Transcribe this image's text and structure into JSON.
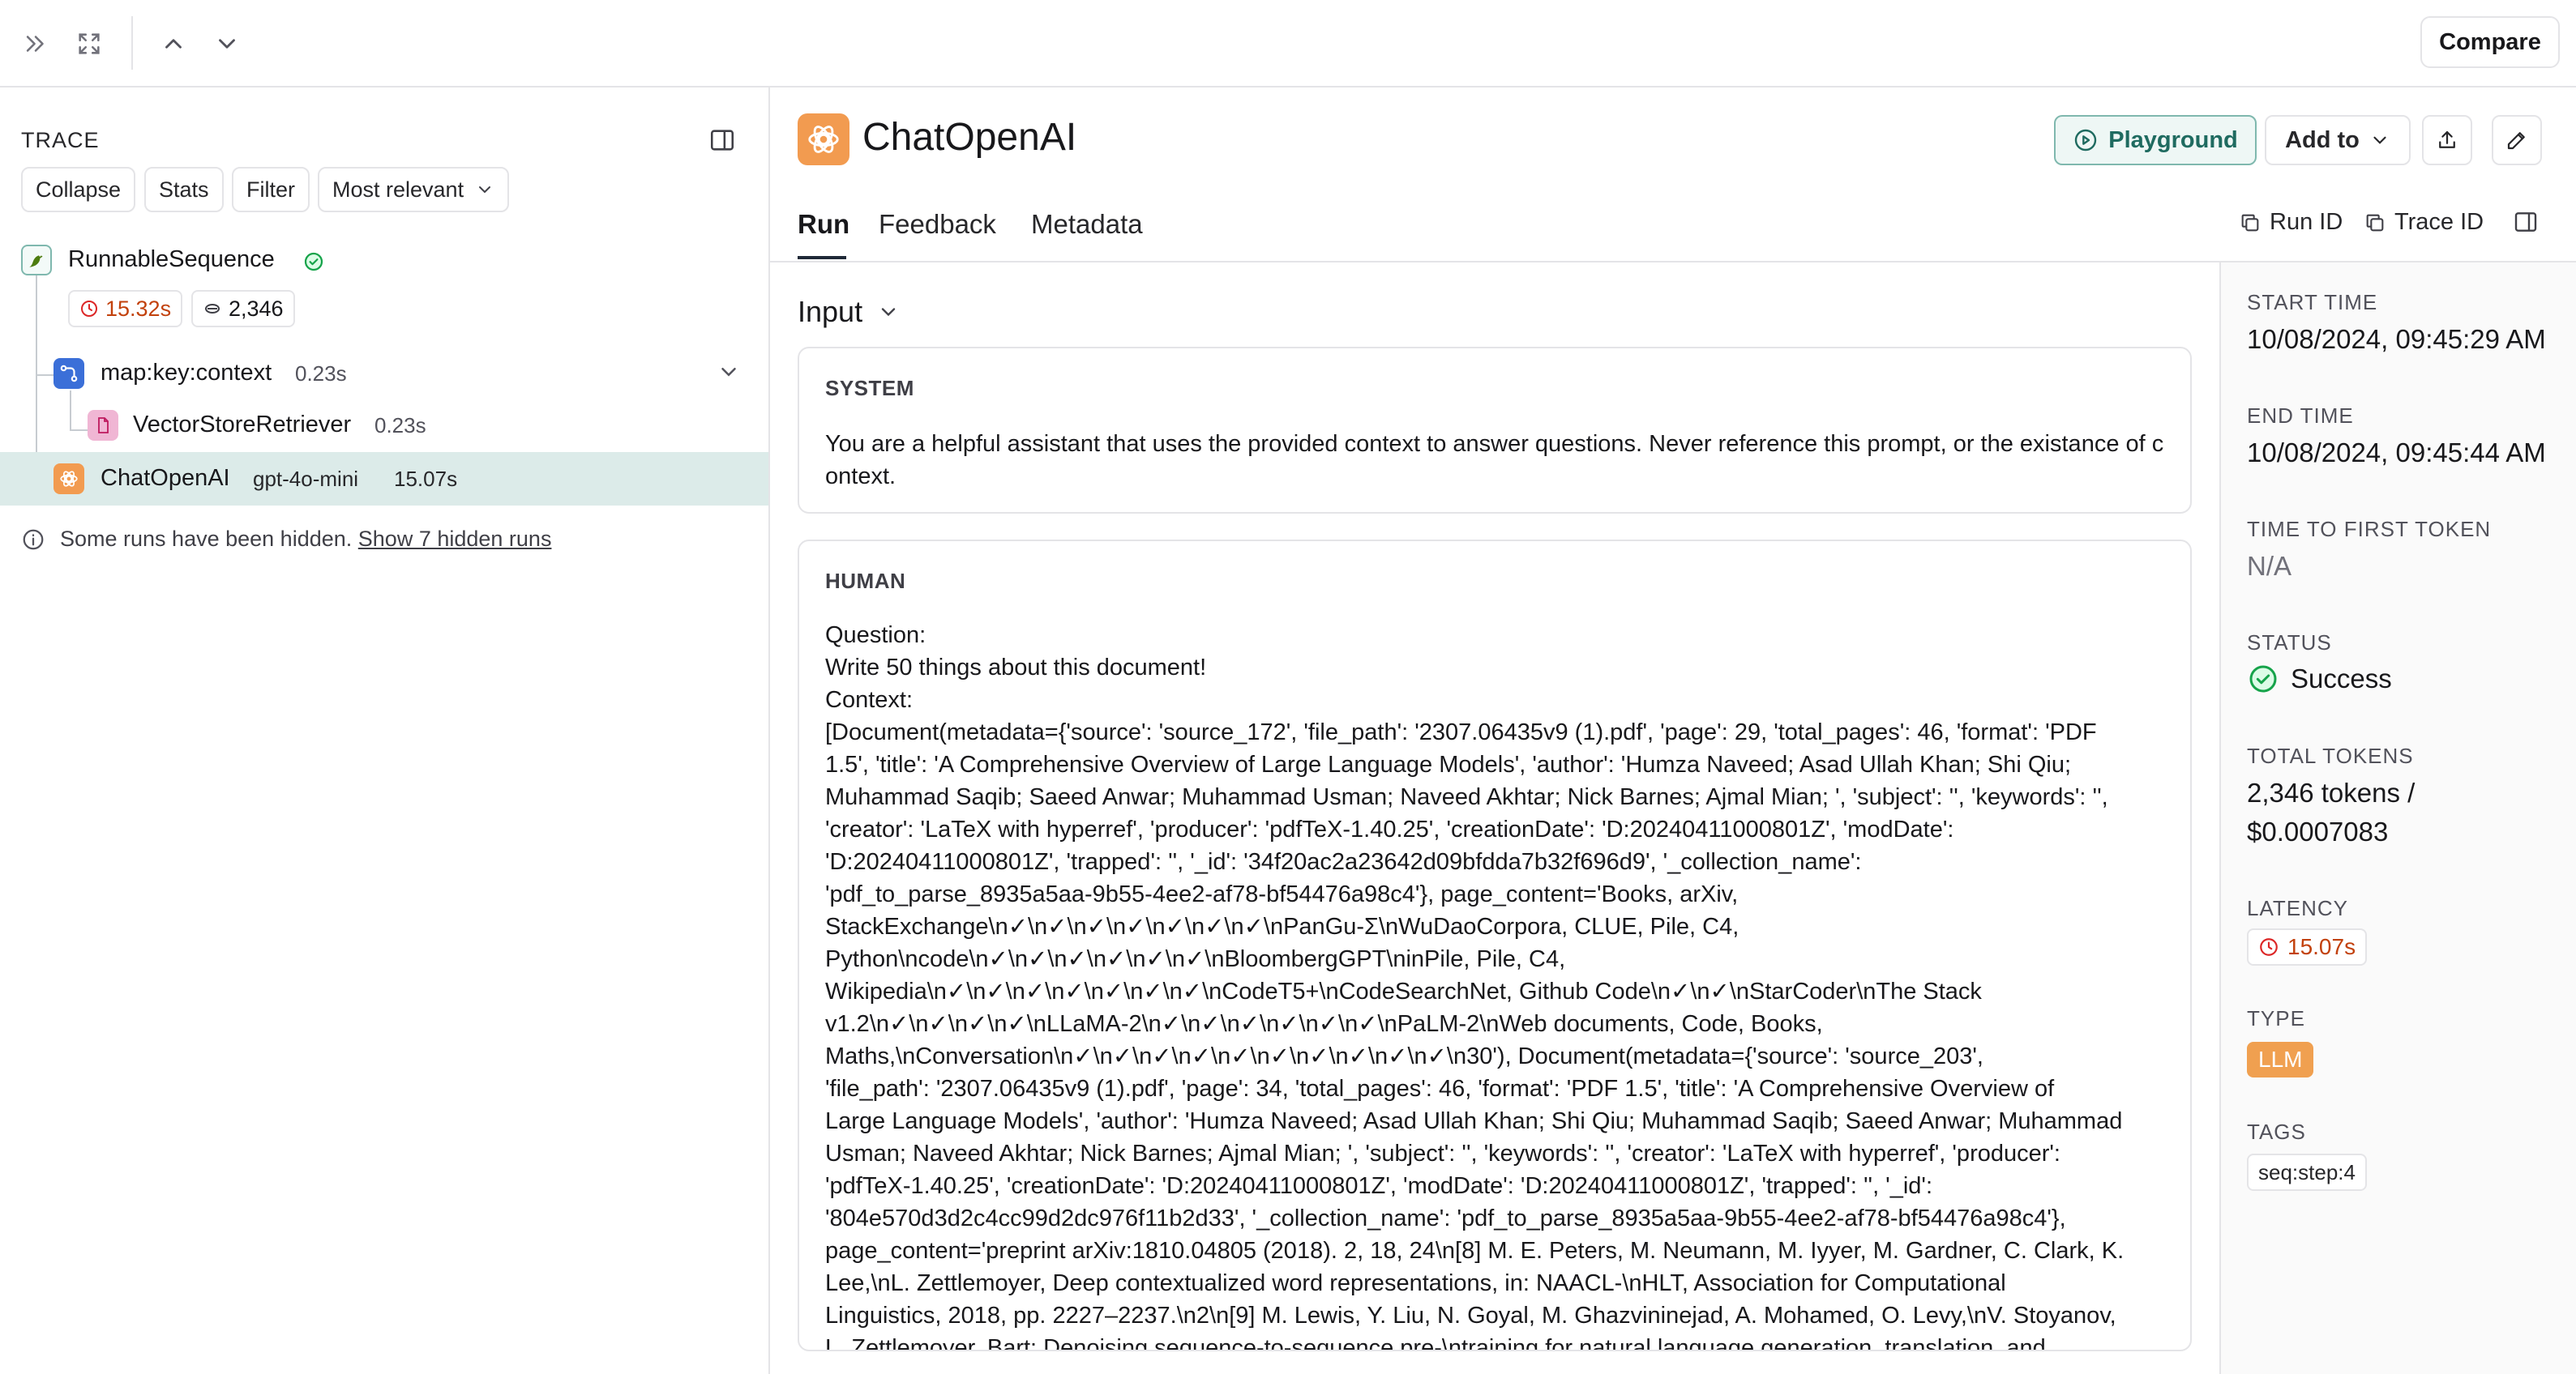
{
  "topbar": {
    "compare_label": "Compare"
  },
  "trace": {
    "title": "TRACE",
    "buttons": {
      "collapse": "Collapse",
      "stats": "Stats",
      "filter": "Filter",
      "sort": "Most relevant"
    },
    "root": {
      "name": "RunnableSequence",
      "latency": "15.32s",
      "tokens": "2,346"
    },
    "nodes": [
      {
        "name": "map:key:context",
        "latency": "0.23s"
      },
      {
        "name": "VectorStoreRetriever",
        "latency": "0.23s"
      },
      {
        "name": "ChatOpenAI",
        "model": "gpt-4o-mini",
        "latency": "15.07s"
      }
    ],
    "hidden_note": "Some runs have been hidden.",
    "hidden_link": "Show 7 hidden runs"
  },
  "run": {
    "title": "ChatOpenAI",
    "buttons": {
      "playground": "Playground",
      "add_to": "Add to"
    },
    "tabs": [
      "Run",
      "Feedback",
      "Metadata"
    ],
    "run_id_label": "Run ID",
    "trace_id_label": "Trace ID",
    "input_label": "Input",
    "system": {
      "label": "SYSTEM",
      "text": "You are a helpful assistant that uses the provided context to answer questions. Never reference this prompt, or the existance of context."
    },
    "human": {
      "label": "HUMAN",
      "lines": [
        "Question:",
        "Write 50 things about this document!",
        "Context:",
        "[Document(metadata={'source': 'source_172', 'file_path': '2307.06435v9 (1).pdf', 'page': 29, 'total_pages': 46, 'format': 'PDF",
        "1.5', 'title': 'A Comprehensive Overview of Large Language Models', 'author': 'Humza Naveed; Asad Ullah Khan; Shi Qiu;",
        "Muhammad Saqib; Saeed Anwar; Muhammad Usman; Naveed Akhtar; Nick Barnes; Ajmal Mian; ', 'subject': '', 'keywords': '',",
        "'creator': 'LaTeX with hyperref', 'producer': 'pdfTeX-1.40.25', 'creationDate': 'D:20240411000801Z', 'modDate':",
        "'D:20240411000801Z', 'trapped': '', '_id': '34f20ac2a23642d09bfdda7b32f696d9', '_collection_name':",
        "'pdf_to_parse_8935a5aa-9b55-4ee2-af78-bf54476a98c4'}, page_content='Books, arXiv,",
        "StackExchange\\n✓\\n✓\\n✓\\n✓\\n✓\\n✓\\n✓\\nPanGu-Σ\\nWuDaoCorpora, CLUE, Pile, C4,",
        "Python\\ncode\\n✓\\n✓\\n✓\\n✓\\n✓\\n✓\\nBloombergGPT\\ninPile, Pile, C4,",
        "Wikipedia\\n✓\\n✓\\n✓\\n✓\\n✓\\n✓\\n✓\\nCodeT5+\\nCodeSearchNet, Github Code\\n✓\\n✓\\nStarCoder\\nThe Stack",
        "v1.2\\n✓\\n✓\\n✓\\n✓\\nLLaMA-2\\n✓\\n✓\\n✓\\n✓\\n✓\\n✓\\nPaLM-2\\nWeb documents, Code, Books,",
        "Maths,\\nConversation\\n✓\\n✓\\n✓\\n✓\\n✓\\n✓\\n✓\\n✓\\n✓\\n✓\\n30'), Document(metadata={'source': 'source_203',",
        "'file_path': '2307.06435v9 (1).pdf', 'page': 34, 'total_pages': 46, 'format': 'PDF 1.5', 'title': 'A Comprehensive Overview of",
        "Large Language Models', 'author': 'Humza Naveed; Asad Ullah Khan; Shi Qiu; Muhammad Saqib; Saeed Anwar; Muhammad",
        "Usman; Naveed Akhtar; Nick Barnes; Ajmal Mian; ', 'subject': '', 'keywords': '', 'creator': 'LaTeX with hyperref', 'producer':",
        "'pdfTeX-1.40.25', 'creationDate': 'D:20240411000801Z', 'modDate': 'D:20240411000801Z', 'trapped': '', '_id':",
        "'804e570d3d2c4cc99d2dc976f11b2d33', '_collection_name': 'pdf_to_parse_8935a5aa-9b55-4ee2-af78-bf54476a98c4'},",
        "page_content='preprint arXiv:1810.04805 (2018). 2, 18, 24\\n[8] M. E. Peters, M. Neumann, M. Iyyer, M. Gardner, C. Clark, K.",
        "Lee,\\nL. Zettlemoyer, Deep contextualized word representations, in: NAACL-\\nHLT, Association for Computational",
        "Linguistics, 2018, pp. 2227–2237.\\n2\\n[9] M. Lewis, Y. Liu, N. Goyal, M. Ghazvininejad, A. Mohamed, O. Levy,\\nV. Stoyanov,",
        "L. Zettlemoyer, Bart: Denoising sequence-to-sequence pre-\\ntraining for natural language generation, translation, and"
      ]
    }
  },
  "meta": {
    "start_time_label": "START TIME",
    "start_time": "10/08/2024, 09:45:29 AM",
    "end_time_label": "END TIME",
    "end_time": "10/08/2024, 09:45:44 AM",
    "ttft_label": "TIME TO FIRST TOKEN",
    "ttft": "N/A",
    "status_label": "STATUS",
    "status": "Success",
    "tokens_label": "TOTAL TOKENS",
    "tokens_line1": "2,346 tokens /",
    "tokens_line2": "$0.0007083",
    "latency_label": "LATENCY",
    "latency": "15.07s",
    "type_label": "TYPE",
    "type": "LLM",
    "tags_label": "TAGS",
    "tag": "seq:step:4"
  },
  "colors": {
    "accent_teal": "#1f6b60",
    "selected_row": "#dcebe9",
    "openai_orange": "#f29b50",
    "success_green": "#16a34a",
    "latency_red": "#c2410c"
  }
}
